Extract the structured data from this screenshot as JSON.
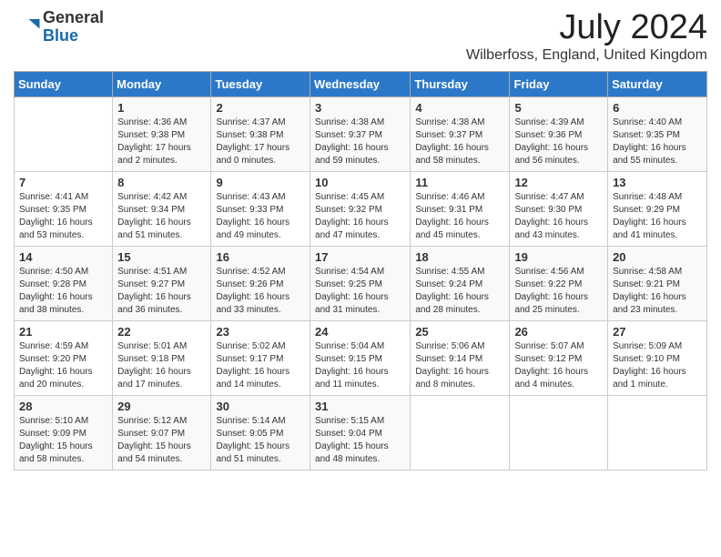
{
  "logo": {
    "general": "General",
    "blue": "Blue"
  },
  "title": {
    "month_year": "July 2024",
    "location": "Wilberfoss, England, United Kingdom"
  },
  "days_of_week": [
    "Sunday",
    "Monday",
    "Tuesday",
    "Wednesday",
    "Thursday",
    "Friday",
    "Saturday"
  ],
  "weeks": [
    [
      {
        "day": "",
        "info": ""
      },
      {
        "day": "1",
        "info": "Sunrise: 4:36 AM\nSunset: 9:38 PM\nDaylight: 17 hours\nand 2 minutes."
      },
      {
        "day": "2",
        "info": "Sunrise: 4:37 AM\nSunset: 9:38 PM\nDaylight: 17 hours\nand 0 minutes."
      },
      {
        "day": "3",
        "info": "Sunrise: 4:38 AM\nSunset: 9:37 PM\nDaylight: 16 hours\nand 59 minutes."
      },
      {
        "day": "4",
        "info": "Sunrise: 4:38 AM\nSunset: 9:37 PM\nDaylight: 16 hours\nand 58 minutes."
      },
      {
        "day": "5",
        "info": "Sunrise: 4:39 AM\nSunset: 9:36 PM\nDaylight: 16 hours\nand 56 minutes."
      },
      {
        "day": "6",
        "info": "Sunrise: 4:40 AM\nSunset: 9:35 PM\nDaylight: 16 hours\nand 55 minutes."
      }
    ],
    [
      {
        "day": "7",
        "info": "Sunrise: 4:41 AM\nSunset: 9:35 PM\nDaylight: 16 hours\nand 53 minutes."
      },
      {
        "day": "8",
        "info": "Sunrise: 4:42 AM\nSunset: 9:34 PM\nDaylight: 16 hours\nand 51 minutes."
      },
      {
        "day": "9",
        "info": "Sunrise: 4:43 AM\nSunset: 9:33 PM\nDaylight: 16 hours\nand 49 minutes."
      },
      {
        "day": "10",
        "info": "Sunrise: 4:45 AM\nSunset: 9:32 PM\nDaylight: 16 hours\nand 47 minutes."
      },
      {
        "day": "11",
        "info": "Sunrise: 4:46 AM\nSunset: 9:31 PM\nDaylight: 16 hours\nand 45 minutes."
      },
      {
        "day": "12",
        "info": "Sunrise: 4:47 AM\nSunset: 9:30 PM\nDaylight: 16 hours\nand 43 minutes."
      },
      {
        "day": "13",
        "info": "Sunrise: 4:48 AM\nSunset: 9:29 PM\nDaylight: 16 hours\nand 41 minutes."
      }
    ],
    [
      {
        "day": "14",
        "info": "Sunrise: 4:50 AM\nSunset: 9:28 PM\nDaylight: 16 hours\nand 38 minutes."
      },
      {
        "day": "15",
        "info": "Sunrise: 4:51 AM\nSunset: 9:27 PM\nDaylight: 16 hours\nand 36 minutes."
      },
      {
        "day": "16",
        "info": "Sunrise: 4:52 AM\nSunset: 9:26 PM\nDaylight: 16 hours\nand 33 minutes."
      },
      {
        "day": "17",
        "info": "Sunrise: 4:54 AM\nSunset: 9:25 PM\nDaylight: 16 hours\nand 31 minutes."
      },
      {
        "day": "18",
        "info": "Sunrise: 4:55 AM\nSunset: 9:24 PM\nDaylight: 16 hours\nand 28 minutes."
      },
      {
        "day": "19",
        "info": "Sunrise: 4:56 AM\nSunset: 9:22 PM\nDaylight: 16 hours\nand 25 minutes."
      },
      {
        "day": "20",
        "info": "Sunrise: 4:58 AM\nSunset: 9:21 PM\nDaylight: 16 hours\nand 23 minutes."
      }
    ],
    [
      {
        "day": "21",
        "info": "Sunrise: 4:59 AM\nSunset: 9:20 PM\nDaylight: 16 hours\nand 20 minutes."
      },
      {
        "day": "22",
        "info": "Sunrise: 5:01 AM\nSunset: 9:18 PM\nDaylight: 16 hours\nand 17 minutes."
      },
      {
        "day": "23",
        "info": "Sunrise: 5:02 AM\nSunset: 9:17 PM\nDaylight: 16 hours\nand 14 minutes."
      },
      {
        "day": "24",
        "info": "Sunrise: 5:04 AM\nSunset: 9:15 PM\nDaylight: 16 hours\nand 11 minutes."
      },
      {
        "day": "25",
        "info": "Sunrise: 5:06 AM\nSunset: 9:14 PM\nDaylight: 16 hours\nand 8 minutes."
      },
      {
        "day": "26",
        "info": "Sunrise: 5:07 AM\nSunset: 9:12 PM\nDaylight: 16 hours\nand 4 minutes."
      },
      {
        "day": "27",
        "info": "Sunrise: 5:09 AM\nSunset: 9:10 PM\nDaylight: 16 hours\nand 1 minute."
      }
    ],
    [
      {
        "day": "28",
        "info": "Sunrise: 5:10 AM\nSunset: 9:09 PM\nDaylight: 15 hours\nand 58 minutes."
      },
      {
        "day": "29",
        "info": "Sunrise: 5:12 AM\nSunset: 9:07 PM\nDaylight: 15 hours\nand 54 minutes."
      },
      {
        "day": "30",
        "info": "Sunrise: 5:14 AM\nSunset: 9:05 PM\nDaylight: 15 hours\nand 51 minutes."
      },
      {
        "day": "31",
        "info": "Sunrise: 5:15 AM\nSunset: 9:04 PM\nDaylight: 15 hours\nand 48 minutes."
      },
      {
        "day": "",
        "info": ""
      },
      {
        "day": "",
        "info": ""
      },
      {
        "day": "",
        "info": ""
      }
    ]
  ]
}
